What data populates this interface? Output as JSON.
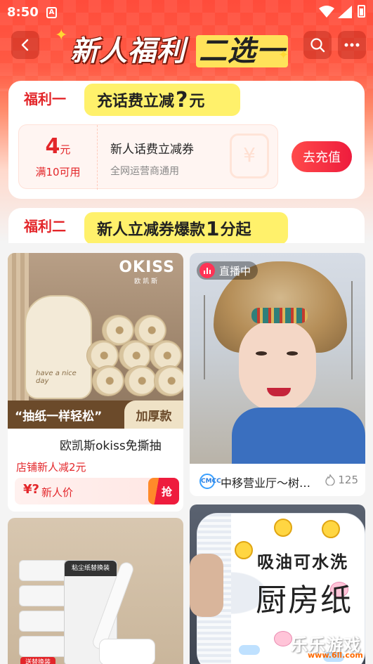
{
  "status_bar": {
    "time": "8:50",
    "notif_letter": "A"
  },
  "header": {
    "title_part1": "新人福利",
    "title_part2": "二选一"
  },
  "benefit1": {
    "label": "福利一",
    "headline_prefix": "充话费立减",
    "headline_q": "?",
    "headline_suffix": "元",
    "coupon": {
      "amount": "4",
      "unit": "元",
      "condition": "满10可用",
      "title": "新人话费立减券",
      "subtitle": "全网运营商通用",
      "watermark_symbol": "¥"
    },
    "button": "去充值"
  },
  "benefit2": {
    "label": "福利二",
    "headline_prefix": "新人立减券爆款",
    "headline_num": "1",
    "headline_suffix": "分起"
  },
  "products": [
    {
      "brand": "OKISS",
      "brand_cn": "欧凯斯",
      "bag_text": "have a nice day",
      "slogan": "“抽纸一样轻松”",
      "tag": "加厚款",
      "title": "欧凯斯okiss免撕抽",
      "promo": "店铺新人减2元",
      "price_symbol": "¥?",
      "price_label": "新人价",
      "grab": "抢"
    },
    {
      "live_label": "直播中",
      "shop_logo": "CMCC",
      "shop": "中移营业厅～树…",
      "likes": "125"
    },
    {
      "pkg_label": "粘尘纸替换装",
      "gift_tag": "送替换装"
    },
    {
      "line1": "吸油可水洗",
      "line2": "厨房纸"
    }
  ],
  "watermark": {
    "text": "乐乐游戏",
    "url": "www.6ll.com"
  },
  "colors": {
    "accent": "#e3262a",
    "highlight": "#fff16b",
    "header": "#ff4c3b"
  }
}
